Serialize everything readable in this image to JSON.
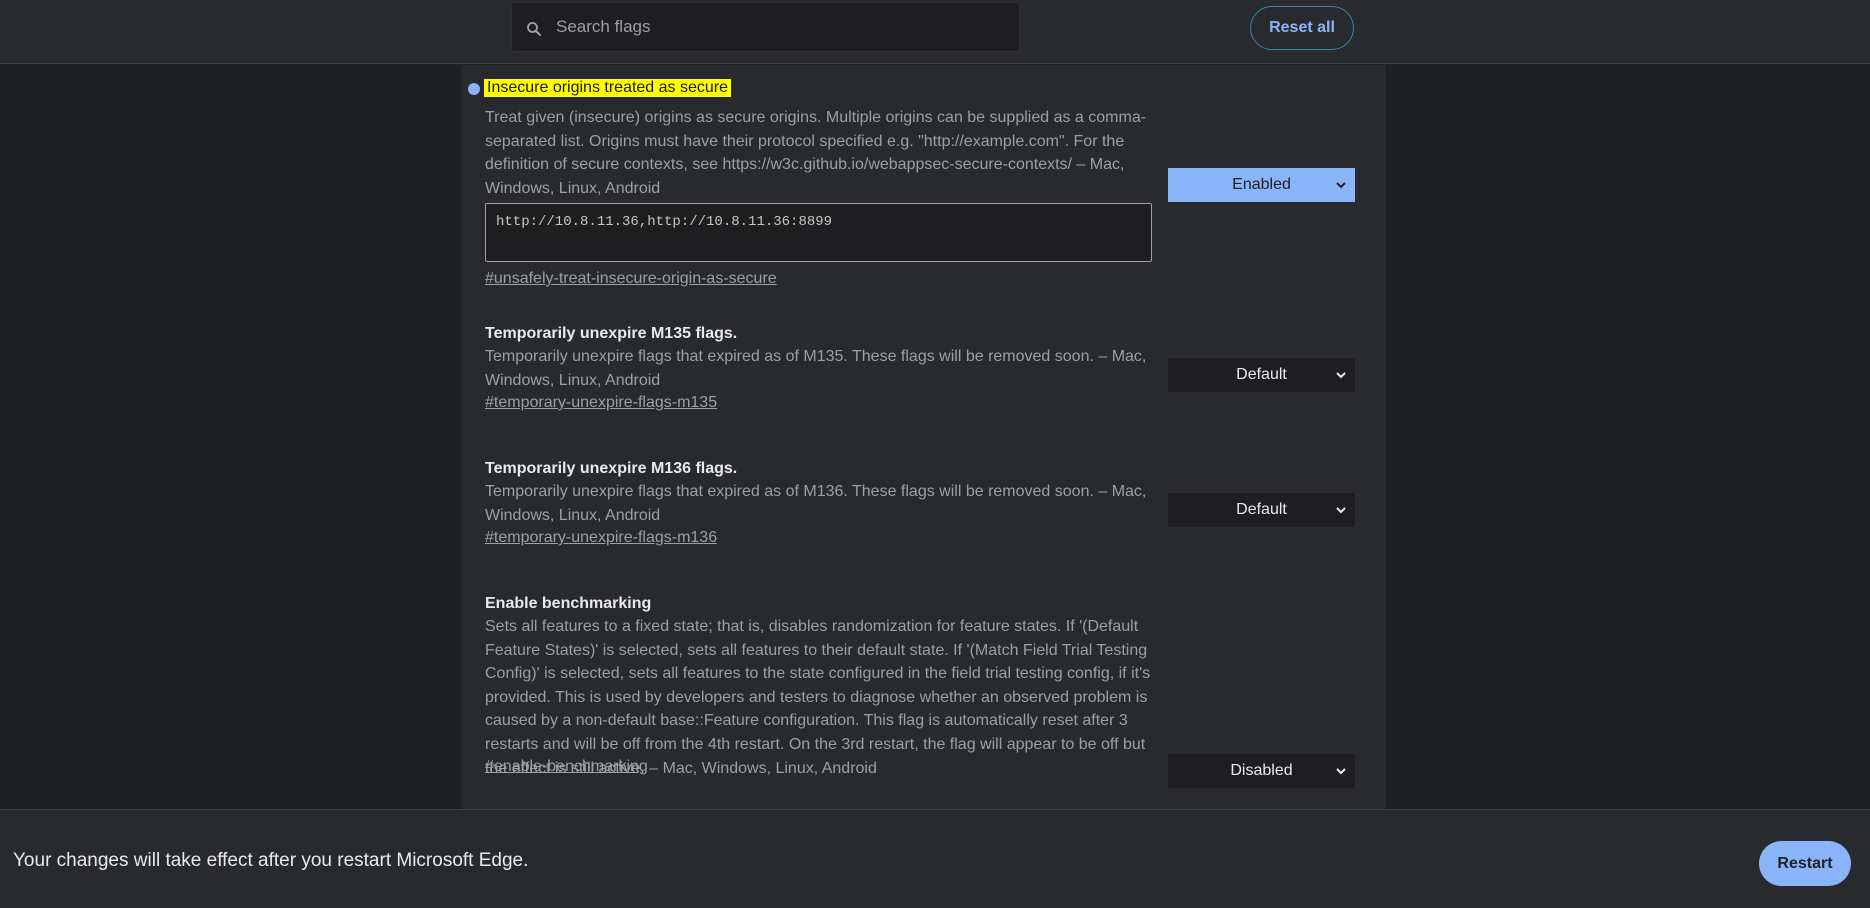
{
  "header": {
    "search_placeholder": "Search flags",
    "reset_label": "Reset all"
  },
  "flags": [
    {
      "title": "Insecure origins treated as secure",
      "modified": true,
      "description": "Treat given (insecure) origins as secure origins. Multiple origins can be supplied as a comma-separated list. Origins must have their protocol specified e.g. \"http://example.com\". For the definition of secure contexts, see https://w3c.github.io/webappsec-secure-contexts/ – Mac, Windows, Linux, Android",
      "input_value": "http://10.8.11.36,http://10.8.11.36:8899",
      "link": "#unsafely-treat-insecure-origin-as-secure",
      "state": "Enabled"
    },
    {
      "title": "Temporarily unexpire M135 flags.",
      "description": "Temporarily unexpire flags that expired as of M135. These flags will be removed soon. – Mac, Windows, Linux, Android",
      "link": "#temporary-unexpire-flags-m135",
      "state": "Default"
    },
    {
      "title": "Temporarily unexpire M136 flags.",
      "description": "Temporarily unexpire flags that expired as of M136. These flags will be removed soon. – Mac, Windows, Linux, Android",
      "link": "#temporary-unexpire-flags-m136",
      "state": "Default"
    },
    {
      "title": "Enable benchmarking",
      "description": "Sets all features to a fixed state; that is, disables randomization for feature states. If '(Default Feature States)' is selected, sets all features to their default state. If '(Match Field Trial Testing Config)' is selected, sets all features to the state configured in the field trial testing config, if it's provided. This is used by developers and testers to diagnose whether an observed problem is caused by a non-default base::Feature configuration. This flag is automatically reset after 3 restarts and will be off from the 4th restart. On the 3rd restart, the flag will appear to be off but the effect is still active. – Mac, Windows, Linux, Android",
      "link": "#enable-benchmarking",
      "state": "Disabled"
    }
  ],
  "restart_bar": {
    "message": "Your changes will take effect after you restart Microsoft Edge.",
    "button_label": "Restart"
  },
  "colors": {
    "accent": "#8ab4f8",
    "highlight": "#ffff00",
    "panel": "#292a2d",
    "background": "#1f2023"
  }
}
